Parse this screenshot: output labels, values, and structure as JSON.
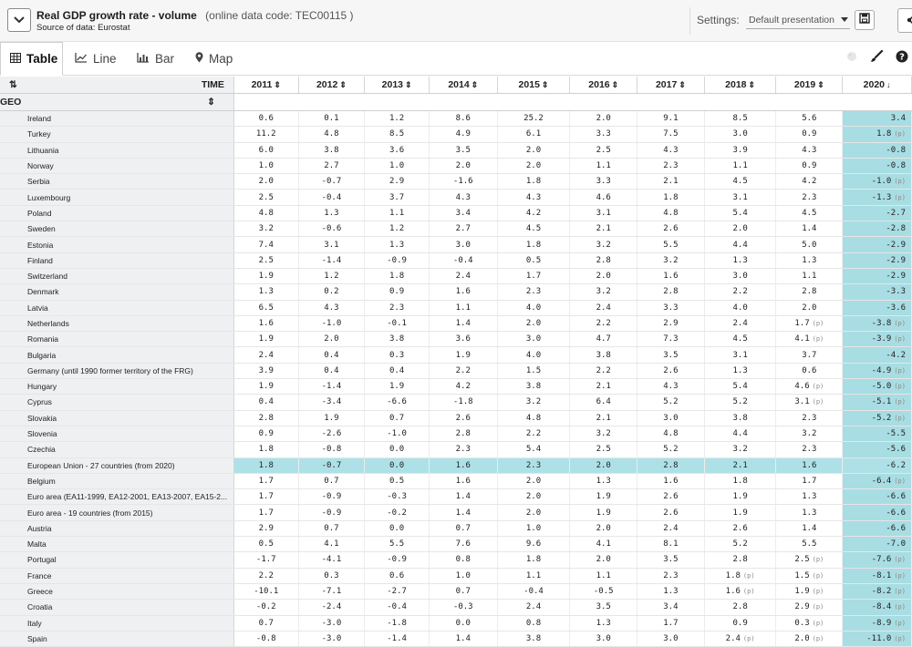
{
  "header": {
    "title": "Real GDP growth rate - volume",
    "code": "(online data code: TEC00115 )",
    "source_label": "Source of data:",
    "source_value": "Eurostat",
    "settings_label": "Settings:",
    "settings_value": "Default presentation"
  },
  "tabs": [
    {
      "label": "Table",
      "icon": "table-icon"
    },
    {
      "label": "Line",
      "icon": "line-chart-icon"
    },
    {
      "label": "Bar",
      "icon": "bar-chart-icon"
    },
    {
      "label": "Map",
      "icon": "map-pin-icon"
    }
  ],
  "table": {
    "time_label": "TIME",
    "geo_label": "GEO",
    "years": [
      "2011",
      "2012",
      "2013",
      "2014",
      "2015",
      "2016",
      "2017",
      "2018",
      "2019",
      "2020"
    ],
    "sort_column": "2020",
    "flag_p": "(p)",
    "rows": [
      {
        "geo": "Ireland",
        "v": [
          "0.6",
          "0.1",
          "1.2",
          "8.6",
          "25.2",
          "2.0",
          "9.1",
          "8.5",
          "5.6",
          "3.4"
        ]
      },
      {
        "geo": "Turkey",
        "v": [
          "11.2",
          "4.8",
          "8.5",
          "4.9",
          "6.1",
          "3.3",
          "7.5",
          "3.0",
          "0.9",
          "1.8"
        ],
        "p": [
          9
        ]
      },
      {
        "geo": "Lithuania",
        "v": [
          "6.0",
          "3.8",
          "3.6",
          "3.5",
          "2.0",
          "2.5",
          "4.3",
          "3.9",
          "4.3",
          "-0.8"
        ]
      },
      {
        "geo": "Norway",
        "v": [
          "1.0",
          "2.7",
          "1.0",
          "2.0",
          "2.0",
          "1.1",
          "2.3",
          "1.1",
          "0.9",
          "-0.8"
        ]
      },
      {
        "geo": "Serbia",
        "v": [
          "2.0",
          "-0.7",
          "2.9",
          "-1.6",
          "1.8",
          "3.3",
          "2.1",
          "4.5",
          "4.2",
          "-1.0"
        ],
        "p": [
          9
        ]
      },
      {
        "geo": "Luxembourg",
        "v": [
          "2.5",
          "-0.4",
          "3.7",
          "4.3",
          "4.3",
          "4.6",
          "1.8",
          "3.1",
          "2.3",
          "-1.3"
        ],
        "p": [
          9
        ]
      },
      {
        "geo": "Poland",
        "v": [
          "4.8",
          "1.3",
          "1.1",
          "3.4",
          "4.2",
          "3.1",
          "4.8",
          "5.4",
          "4.5",
          "-2.7"
        ]
      },
      {
        "geo": "Sweden",
        "v": [
          "3.2",
          "-0.6",
          "1.2",
          "2.7",
          "4.5",
          "2.1",
          "2.6",
          "2.0",
          "1.4",
          "-2.8"
        ]
      },
      {
        "geo": "Estonia",
        "v": [
          "7.4",
          "3.1",
          "1.3",
          "3.0",
          "1.8",
          "3.2",
          "5.5",
          "4.4",
          "5.0",
          "-2.9"
        ]
      },
      {
        "geo": "Finland",
        "v": [
          "2.5",
          "-1.4",
          "-0.9",
          "-0.4",
          "0.5",
          "2.8",
          "3.2",
          "1.3",
          "1.3",
          "-2.9"
        ]
      },
      {
        "geo": "Switzerland",
        "v": [
          "1.9",
          "1.2",
          "1.8",
          "2.4",
          "1.7",
          "2.0",
          "1.6",
          "3.0",
          "1.1",
          "-2.9"
        ]
      },
      {
        "geo": "Denmark",
        "v": [
          "1.3",
          "0.2",
          "0.9",
          "1.6",
          "2.3",
          "3.2",
          "2.8",
          "2.2",
          "2.8",
          "-3.3"
        ]
      },
      {
        "geo": "Latvia",
        "v": [
          "6.5",
          "4.3",
          "2.3",
          "1.1",
          "4.0",
          "2.4",
          "3.3",
          "4.0",
          "2.0",
          "-3.6"
        ]
      },
      {
        "geo": "Netherlands",
        "v": [
          "1.6",
          "-1.0",
          "-0.1",
          "1.4",
          "2.0",
          "2.2",
          "2.9",
          "2.4",
          "1.7",
          "-3.8"
        ],
        "p": [
          8,
          9
        ]
      },
      {
        "geo": "Romania",
        "v": [
          "1.9",
          "2.0",
          "3.8",
          "3.6",
          "3.0",
          "4.7",
          "7.3",
          "4.5",
          "4.1",
          "-3.9"
        ],
        "p": [
          8,
          9
        ]
      },
      {
        "geo": "Bulgaria",
        "v": [
          "2.4",
          "0.4",
          "0.3",
          "1.9",
          "4.0",
          "3.8",
          "3.5",
          "3.1",
          "3.7",
          "-4.2"
        ]
      },
      {
        "geo": "Germany (until 1990 former territory of the FRG)",
        "v": [
          "3.9",
          "0.4",
          "0.4",
          "2.2",
          "1.5",
          "2.2",
          "2.6",
          "1.3",
          "0.6",
          "-4.9"
        ],
        "p": [
          9
        ]
      },
      {
        "geo": "Hungary",
        "v": [
          "1.9",
          "-1.4",
          "1.9",
          "4.2",
          "3.8",
          "2.1",
          "4.3",
          "5.4",
          "4.6",
          "-5.0"
        ],
        "p": [
          8,
          9
        ]
      },
      {
        "geo": "Cyprus",
        "v": [
          "0.4",
          "-3.4",
          "-6.6",
          "-1.8",
          "3.2",
          "6.4",
          "5.2",
          "5.2",
          "3.1",
          "-5.1"
        ],
        "p": [
          8,
          9
        ]
      },
      {
        "geo": "Slovakia",
        "v": [
          "2.8",
          "1.9",
          "0.7",
          "2.6",
          "4.8",
          "2.1",
          "3.0",
          "3.8",
          "2.3",
          "-5.2"
        ],
        "p": [
          9
        ]
      },
      {
        "geo": "Slovenia",
        "v": [
          "0.9",
          "-2.6",
          "-1.0",
          "2.8",
          "2.2",
          "3.2",
          "4.8",
          "4.4",
          "3.2",
          "-5.5"
        ]
      },
      {
        "geo": "Czechia",
        "v": [
          "1.8",
          "-0.8",
          "0.0",
          "2.3",
          "5.4",
          "2.5",
          "5.2",
          "3.2",
          "2.3",
          "-5.6"
        ]
      },
      {
        "geo": "European Union - 27 countries (from 2020)",
        "v": [
          "1.8",
          "-0.7",
          "0.0",
          "1.6",
          "2.3",
          "2.0",
          "2.8",
          "2.1",
          "1.6",
          "-6.2"
        ],
        "highlight": true
      },
      {
        "geo": "Belgium",
        "v": [
          "1.7",
          "0.7",
          "0.5",
          "1.6",
          "2.0",
          "1.3",
          "1.6",
          "1.8",
          "1.7",
          "-6.4"
        ],
        "p": [
          9
        ]
      },
      {
        "geo": "Euro area (EA11-1999, EA12-2001, EA13-2007, EA15-2...",
        "v": [
          "1.7",
          "-0.9",
          "-0.3",
          "1.4",
          "2.0",
          "1.9",
          "2.6",
          "1.9",
          "1.3",
          "-6.6"
        ]
      },
      {
        "geo": "Euro area - 19 countries (from 2015)",
        "v": [
          "1.7",
          "-0.9",
          "-0.2",
          "1.4",
          "2.0",
          "1.9",
          "2.6",
          "1.9",
          "1.3",
          "-6.6"
        ]
      },
      {
        "geo": "Austria",
        "v": [
          "2.9",
          "0.7",
          "0.0",
          "0.7",
          "1.0",
          "2.0",
          "2.4",
          "2.6",
          "1.4",
          "-6.6"
        ]
      },
      {
        "geo": "Malta",
        "v": [
          "0.5",
          "4.1",
          "5.5",
          "7.6",
          "9.6",
          "4.1",
          "8.1",
          "5.2",
          "5.5",
          "-7.0"
        ]
      },
      {
        "geo": "Portugal",
        "v": [
          "-1.7",
          "-4.1",
          "-0.9",
          "0.8",
          "1.8",
          "2.0",
          "3.5",
          "2.8",
          "2.5",
          "-7.6"
        ],
        "p": [
          8,
          9
        ]
      },
      {
        "geo": "France",
        "v": [
          "2.2",
          "0.3",
          "0.6",
          "1.0",
          "1.1",
          "1.1",
          "2.3",
          "1.8",
          "1.5",
          "-8.1"
        ],
        "p": [
          7,
          8,
          9
        ]
      },
      {
        "geo": "Greece",
        "v": [
          "-10.1",
          "-7.1",
          "-2.7",
          "0.7",
          "-0.4",
          "-0.5",
          "1.3",
          "1.6",
          "1.9",
          "-8.2"
        ],
        "p": [
          7,
          8,
          9
        ]
      },
      {
        "geo": "Croatia",
        "v": [
          "-0.2",
          "-2.4",
          "-0.4",
          "-0.3",
          "2.4",
          "3.5",
          "3.4",
          "2.8",
          "2.9",
          "-8.4"
        ],
        "p": [
          8,
          9
        ]
      },
      {
        "geo": "Italy",
        "v": [
          "0.7",
          "-3.0",
          "-1.8",
          "0.0",
          "0.8",
          "1.3",
          "1.7",
          "0.9",
          "0.3",
          "-8.9"
        ],
        "p": [
          8,
          9
        ]
      },
      {
        "geo": "Spain",
        "v": [
          "-0.8",
          "-3.0",
          "-1.4",
          "1.4",
          "3.8",
          "3.0",
          "3.0",
          "2.4",
          "2.0",
          "-11.0"
        ],
        "p": [
          7,
          8,
          9
        ]
      }
    ]
  },
  "colors": {
    "last_column_bg": "#a8dde3",
    "highlight_row_bg": "#aee1e7",
    "geo_column_bg": "#eef0f2"
  }
}
